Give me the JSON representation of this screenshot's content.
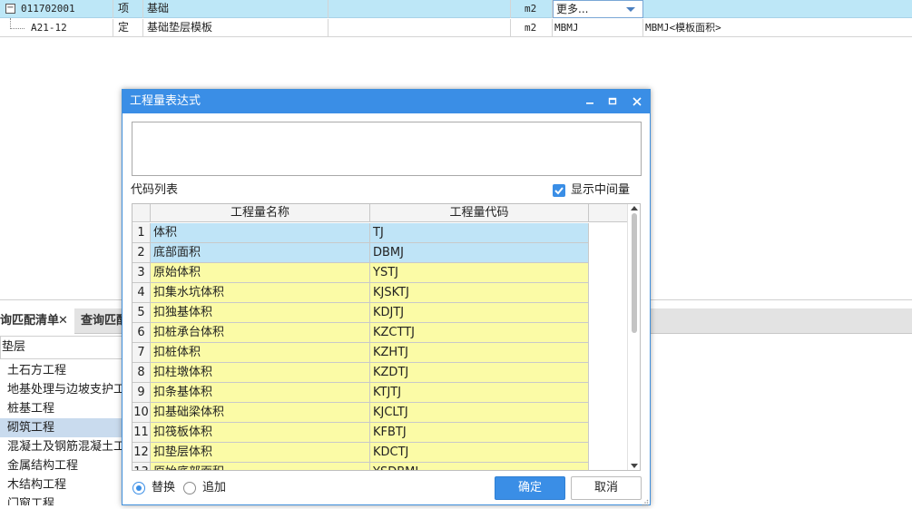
{
  "grid": {
    "rows": [
      {
        "code": "011702001",
        "type": "项",
        "name": "基础",
        "unit": "m2",
        "expr": "更多...",
        "expr_desc": ""
      },
      {
        "code": "A21-12",
        "type": "定",
        "name": "基础垫层模板",
        "unit": "m2",
        "expr": "MBMJ",
        "expr_desc": "MBMJ<模板面积>"
      }
    ]
  },
  "background": {
    "tabs": [
      {
        "label": "询匹配清单"
      },
      {
        "label": "查询匹配"
      }
    ],
    "search_value": "垫层",
    "tree_items": [
      {
        "label": "土石方工程"
      },
      {
        "label": "地基处理与边坡支护工程"
      },
      {
        "label": "桩基工程"
      },
      {
        "label": "砌筑工程"
      },
      {
        "label": "混凝土及钢筋混凝土工程"
      },
      {
        "label": "金属结构工程"
      },
      {
        "label": "木结构工程"
      },
      {
        "label": "门窗工程"
      }
    ]
  },
  "dialog": {
    "title": "工程量表达式",
    "expression_value": "",
    "code_list_label": "代码列表",
    "show_intermediate_label": "显示中间量",
    "show_intermediate_checked": true,
    "columns": {
      "name": "工程量名称",
      "code": "工程量代码"
    },
    "rows": [
      {
        "no": "1",
        "name": "体积",
        "code": "TJ"
      },
      {
        "no": "2",
        "name": "底部面积",
        "code": "DBMJ"
      },
      {
        "no": "3",
        "name": "原始体积",
        "code": "YSTJ"
      },
      {
        "no": "4",
        "name": "扣集水坑体积",
        "code": "KJSKTJ"
      },
      {
        "no": "5",
        "name": "扣独基体积",
        "code": "KDJTJ"
      },
      {
        "no": "6",
        "name": "扣桩承台体积",
        "code": "KZCTTJ"
      },
      {
        "no": "7",
        "name": "扣桩体积",
        "code": "KZHTJ"
      },
      {
        "no": "8",
        "name": "扣柱墩体积",
        "code": "KZDTJ"
      },
      {
        "no": "9",
        "name": "扣条基体积",
        "code": "KTJTJ"
      },
      {
        "no": "10",
        "name": "扣基础梁体积",
        "code": "KJCLTJ"
      },
      {
        "no": "11",
        "name": "扣筏板体积",
        "code": "KFBTJ"
      },
      {
        "no": "12",
        "name": "扣垫层体积",
        "code": "KDCTJ"
      },
      {
        "no": "13",
        "name": "原始底部面积",
        "code": "YSDBMJ"
      }
    ],
    "mode_replace_label": "替换",
    "mode_append_label": "追加",
    "mode_selected": "替换",
    "ok_label": "确定",
    "cancel_label": "取消"
  },
  "colors": {
    "accent": "#3a8ee6",
    "row_selected": "#bfe4f7",
    "row_default": "#fbfba6",
    "top_row_selected": "#bde7f7"
  }
}
